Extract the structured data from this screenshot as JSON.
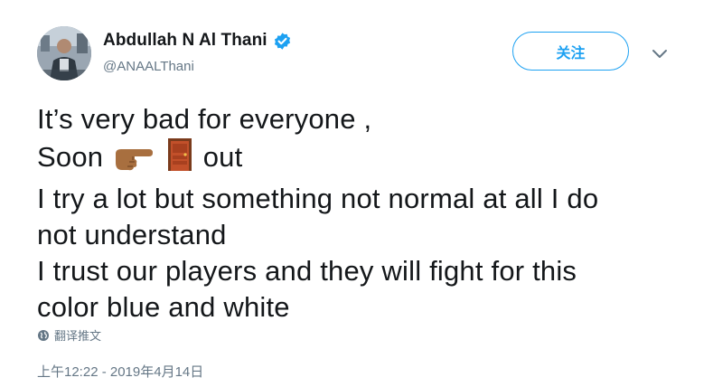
{
  "tweet": {
    "author": {
      "display_name": "Abdullah N Al Thani",
      "handle": "@ANAALThani",
      "verified": true,
      "avatar_icon": "user-avatar"
    },
    "follow_label": "关注",
    "menu_icon": "chevron-down-icon",
    "text_lines": {
      "l1": "It’s very bad for everyone ,",
      "l2_start": "Soon",
      "l2_end": "out",
      "l3": "I try a lot but something not normal at all I do",
      "l4": "not understand",
      "l5": "I trust our players and they will fight for this",
      "l6": "color blue and white"
    },
    "emojis": [
      "pointing-right-icon",
      "door-icon"
    ],
    "translate_label": "翻译推文",
    "timestamp": "上午12:22 - 2019年4月14日"
  },
  "colors": {
    "accent": "#1da1f2",
    "text": "#14171a",
    "secondary": "#657786"
  }
}
